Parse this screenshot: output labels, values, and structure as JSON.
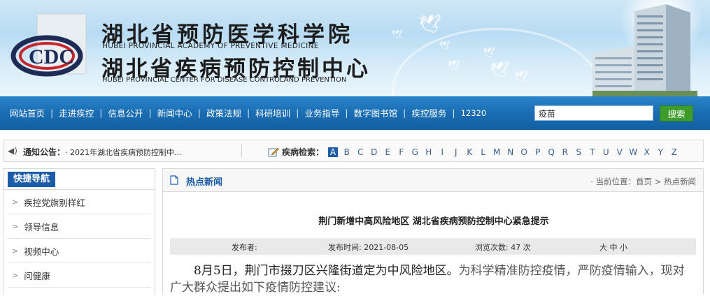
{
  "header": {
    "cn_title_1": "湖北省预防医学科学院",
    "en_title_1": "HUBEI PROVINCIAL ACADEMY OF PREVENTIVE MEDICINE",
    "cn_title_2": "湖北省疾病预防控制中心",
    "en_title_2": "HUBEI PROVINCIAL CENTER FOR DISEASE CONTROLAND PREVENTION"
  },
  "nav": {
    "items": [
      "网站首页",
      "走进疾控",
      "信息公开",
      "新闻中心",
      "政策法规",
      "科研培训",
      "业务指导",
      "数字图书馆",
      "疾控服务",
      "12320"
    ],
    "search_value": "疫苗",
    "search_button": "搜索"
  },
  "notice": {
    "label": "通知公告：",
    "text": "· 2021年湖北省疾病预防控制中...",
    "disease_label": "疾病检索：",
    "letters": [
      "A",
      "B",
      "C",
      "D",
      "E",
      "F",
      "G",
      "H",
      "I",
      "J",
      "K",
      "L",
      "M",
      "N",
      "O",
      "P",
      "Q",
      "R",
      "S",
      "T",
      "U",
      "V",
      "W",
      "X",
      "Y",
      "Z"
    ],
    "active_letter": "A"
  },
  "sidebar": {
    "title": "快捷导航",
    "items": [
      "疾控党旗别样红",
      "领导信息",
      "视频中心",
      "问健康"
    ]
  },
  "main": {
    "section_title": "热点新闻",
    "breadcrumb": "· 当前位置：首页 > 热点新闻",
    "article_title": "荆门新增中高风险地区 湖北省疾病预防控制中心紧急提示",
    "publisher_label": "发布者:",
    "date_label": "发布时间: 2021-08-05",
    "views_label": "浏览次数: 47 次",
    "font_size": "大 中 小",
    "body_highlight": "8月5日，荆门市掇刀区兴隆街道定为中风险地区。",
    "body_rest": "为科学精准防控疫情，严防疫情输入，现对广大群众提出如下疫情防控建议:"
  },
  "colors": {
    "nav_blue": "#1a6db3",
    "accent_blue": "#1d5da8",
    "search_green": "#3d9c2a"
  }
}
